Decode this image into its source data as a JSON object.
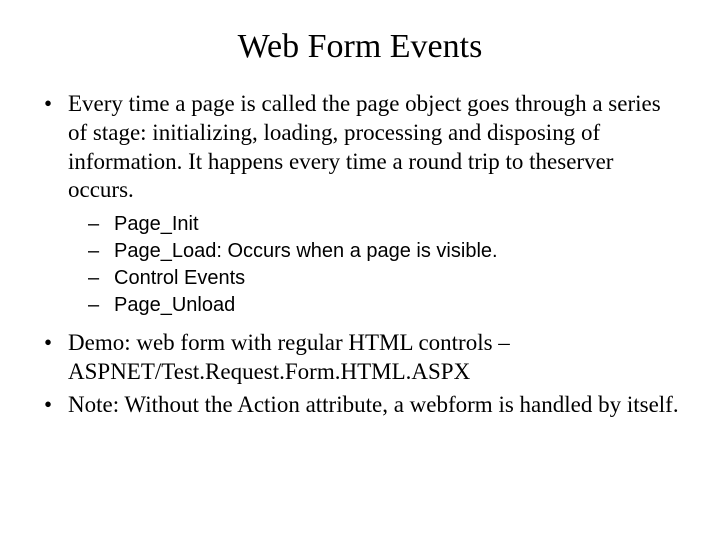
{
  "title": "Web Form Events",
  "bullets": [
    {
      "text": "Every time a page is called the page object goes through a series of stage: initializing, loading, processing and disposing of information.  It happens every time a round trip to theserver occurs.",
      "subs": [
        "Page_Init",
        "Page_Load: Occurs when a page is visible.",
        "Control Events",
        "Page_Unload"
      ]
    },
    {
      "text": "Demo: web form with regular HTML controls – ASPNET/Test.Request.Form.HTML.ASPX"
    },
    {
      "text": "Note: Without the Action attribute, a webform is handled by itself."
    }
  ],
  "markers": {
    "bullet": "•",
    "sub": "–"
  }
}
